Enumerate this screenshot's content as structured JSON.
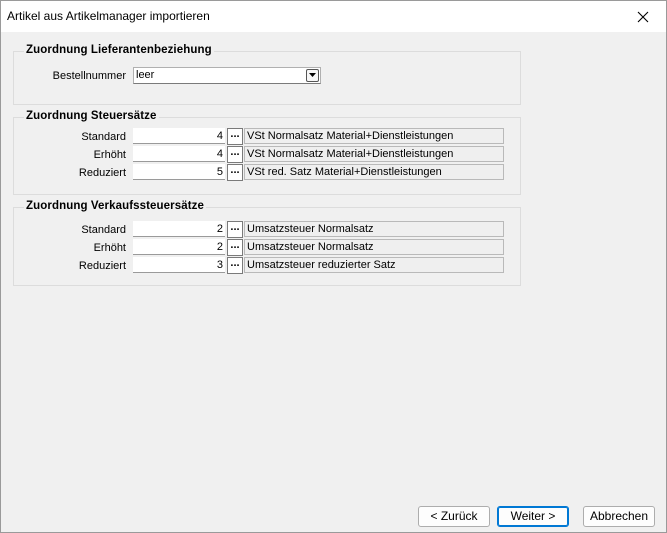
{
  "window": {
    "title": "Artikel aus Artikelmanager importieren"
  },
  "group_supplier": {
    "legend": "Zuordnung Lieferantenbeziehung",
    "order_number_label": "Bestellnummer",
    "order_number_value": "leer"
  },
  "group_tax": {
    "legend": "Zuordnung Steuersätze",
    "rows": [
      {
        "label": "Standard",
        "value": "4",
        "button": "...",
        "description": "VSt Normalsatz Material+Dienstleistungen"
      },
      {
        "label": "Erhöht",
        "value": "4",
        "button": "...",
        "description": "VSt Normalsatz Material+Dienstleistungen"
      },
      {
        "label": "Reduziert",
        "value": "5",
        "button": "...",
        "description": "VSt red. Satz Material+Dienstleistungen"
      }
    ]
  },
  "group_sales_tax": {
    "legend": "Zuordnung Verkaufssteuersätze",
    "rows": [
      {
        "label": "Standard",
        "value": "2",
        "button": "...",
        "description": "Umsatzsteuer Normalsatz"
      },
      {
        "label": "Erhöht",
        "value": "2",
        "button": "...",
        "description": "Umsatzsteuer Normalsatz"
      },
      {
        "label": "Reduziert",
        "value": "3",
        "button": "...",
        "description": "Umsatzsteuer reduzierter Satz"
      }
    ]
  },
  "buttons": {
    "back": "< Zurück",
    "next": "Weiter >",
    "cancel": "Abbrechen"
  },
  "icons": {
    "close": "close-icon",
    "dropdown": "chevron-down-icon"
  }
}
